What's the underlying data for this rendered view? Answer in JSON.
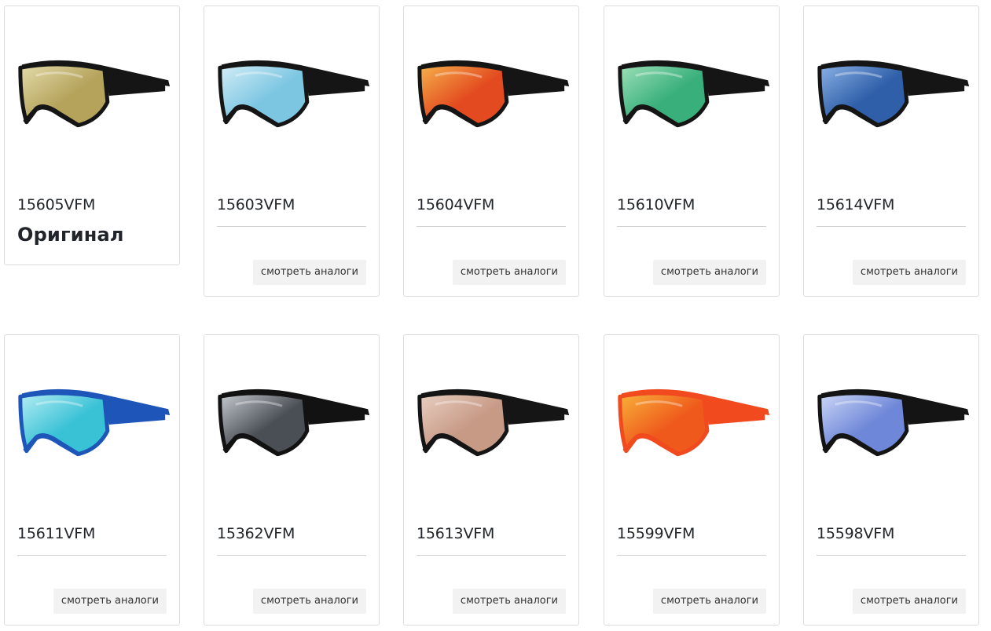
{
  "products": [
    {
      "code": "15605VFM",
      "badge": "Оригинал",
      "lens": "#b5a35c",
      "lens_hi": "#e4dcab",
      "frame": "#151515"
    },
    {
      "code": "15603VFM",
      "button": "смотреть аналоги",
      "lens": "#7cc6e2",
      "lens_hi": "#d4eef7",
      "frame": "#151515"
    },
    {
      "code": "15604VFM",
      "button": "смотреть аналоги",
      "lens": "#e34a1f",
      "lens_hi": "#f6b34c",
      "frame": "#151515"
    },
    {
      "code": "15610VFM",
      "button": "смотреть аналоги",
      "lens": "#39b07c",
      "lens_hi": "#9fe0b8",
      "frame": "#151515"
    },
    {
      "code": "15614VFM",
      "button": "смотреть аналоги",
      "lens": "#2f5fa9",
      "lens_hi": "#8cb2e6",
      "frame": "#151515"
    },
    {
      "code": "15611VFM",
      "button": "смотреть аналоги",
      "lens": "#39c1d6",
      "lens_hi": "#b6eef4",
      "frame": "#1e55b8"
    },
    {
      "code": "15362VFM",
      "button": "смотреть аналоги",
      "lens": "#4a4f55",
      "lens_hi": "#c8cdd3",
      "frame": "#121212"
    },
    {
      "code": "15613VFM",
      "button": "смотреть аналоги",
      "lens": "#c79a86",
      "lens_hi": "#ead0c3",
      "frame": "#151515"
    },
    {
      "code": "15599VFM",
      "button": "смотреть аналоги",
      "lens": "#ef5a1c",
      "lens_hi": "#f8b23a",
      "frame": "#f04a1e"
    },
    {
      "code": "15598VFM",
      "button": "смотреть аналоги",
      "lens": "#6f87d8",
      "lens_hi": "#cdd8f7",
      "frame": "#141414"
    }
  ]
}
